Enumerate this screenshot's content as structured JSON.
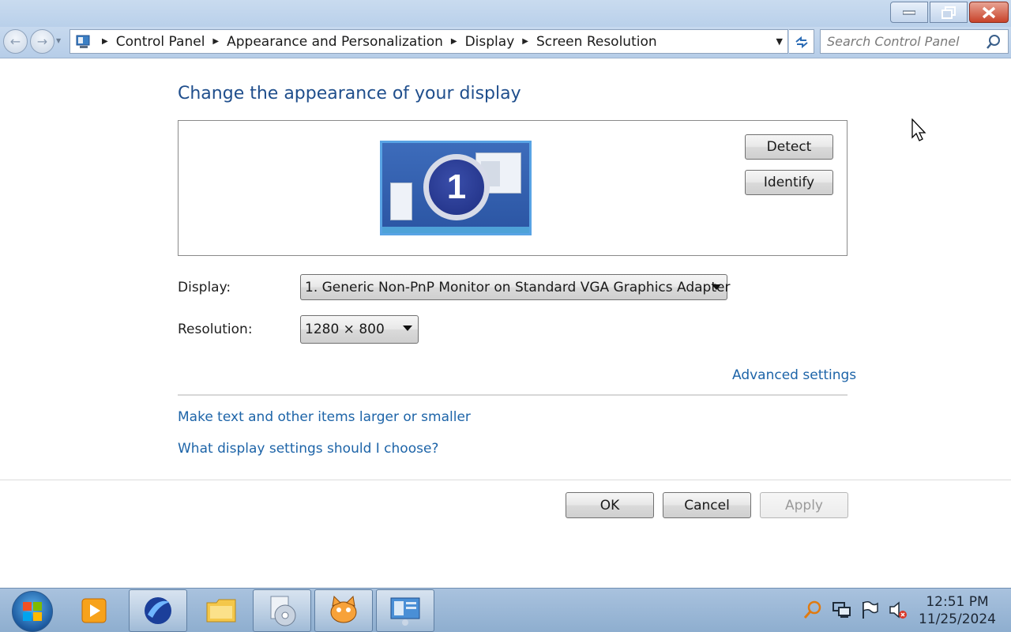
{
  "window": {
    "caption_buttons": [
      "minimize-icon",
      "restore-icon",
      "close-icon"
    ]
  },
  "navbar": {
    "breadcrumbs": [
      "Control Panel",
      "Appearance and Personalization",
      "Display",
      "Screen Resolution"
    ],
    "search_placeholder": "Search Control Panel"
  },
  "main": {
    "heading": "Change the appearance of your display",
    "monitor_number": "1",
    "detect_label": "Detect",
    "identify_label": "Identify",
    "display_label": "Display:",
    "display_value": "1. Generic Non-PnP Monitor on Standard VGA Graphics Adapter",
    "resolution_label": "Resolution:",
    "resolution_value": "1280 × 800",
    "advanced_link": "Advanced settings",
    "text_size_link": "Make text and other items larger or smaller",
    "help_link": "What display settings should I choose?"
  },
  "footer": {
    "ok_label": "OK",
    "cancel_label": "Cancel",
    "apply_label": "Apply"
  },
  "taskbar": {
    "pinned": [
      "media-player-icon",
      "browser-icon",
      "file-explorer-icon",
      "disc-burner-icon",
      "scratch-cat-icon",
      "control-panel-icon"
    ],
    "time": "12:51 PM",
    "date": "11/25/2024"
  },
  "colors": {
    "heading": "#1f4e8c",
    "link": "#1d64a8",
    "monitor_screen": "#3d6cbb"
  }
}
